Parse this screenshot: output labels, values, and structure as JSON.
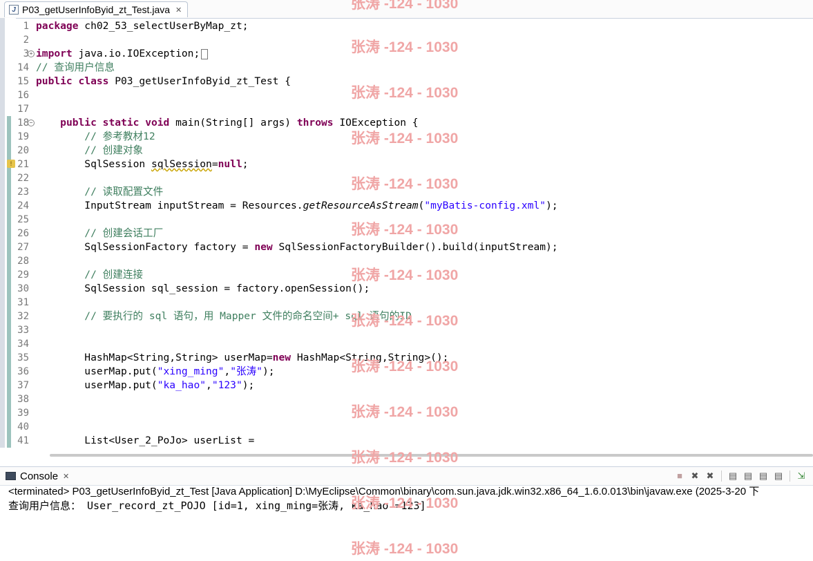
{
  "editor_tab": {
    "title": "P03_getUserInfoByid_zt_Test.java",
    "close": "✕"
  },
  "code_lines": [
    {
      "num": "1",
      "parts": [
        {
          "t": "package",
          "c": "kw"
        },
        {
          "t": " ch02_53_selectUserByMap_zt;"
        }
      ]
    },
    {
      "num": "2",
      "parts": []
    },
    {
      "num": "3",
      "fold": "+",
      "parts": [
        {
          "t": "import",
          "c": "kw"
        },
        {
          "t": " java.io.IOException;"
        }
      ],
      "boxed": true
    },
    {
      "num": "14",
      "parts": [
        {
          "t": "// 查询用户信息",
          "c": "cm"
        }
      ]
    },
    {
      "num": "15",
      "parts": [
        {
          "t": "public",
          "c": "kw"
        },
        {
          "t": " "
        },
        {
          "t": "class",
          "c": "kw"
        },
        {
          "t": " P03_getUserInfoByid_zt_Test {"
        }
      ]
    },
    {
      "num": "16",
      "parts": []
    },
    {
      "num": "17",
      "parts": []
    },
    {
      "num": "18",
      "fold": "−",
      "parts": [
        {
          "t": "    "
        },
        {
          "t": "public",
          "c": "kw"
        },
        {
          "t": " "
        },
        {
          "t": "static",
          "c": "kw"
        },
        {
          "t": " "
        },
        {
          "t": "void",
          "c": "kw"
        },
        {
          "t": " main(String[] args) "
        },
        {
          "t": "throws",
          "c": "kw"
        },
        {
          "t": " IOException {"
        }
      ]
    },
    {
      "num": "19",
      "parts": [
        {
          "t": "        "
        },
        {
          "t": "// 参考教材12",
          "c": "cm"
        }
      ]
    },
    {
      "num": "20",
      "parts": [
        {
          "t": "        "
        },
        {
          "t": "// 创建对象",
          "c": "cm"
        }
      ]
    },
    {
      "num": "21",
      "warn": true,
      "parts": [
        {
          "t": "        SqlSession "
        },
        {
          "t": "sqlSession",
          "c": "squig"
        },
        {
          "t": "="
        },
        {
          "t": "null",
          "c": "kw"
        },
        {
          "t": ";"
        }
      ]
    },
    {
      "num": "22",
      "parts": []
    },
    {
      "num": "23",
      "parts": [
        {
          "t": "        "
        },
        {
          "t": "// 读取配置文件",
          "c": "cm"
        }
      ]
    },
    {
      "num": "24",
      "parts": [
        {
          "t": "        InputStream inputStream = Resources."
        },
        {
          "t": "getResourceAsStream",
          "c": "it"
        },
        {
          "t": "("
        },
        {
          "t": "\"myBatis-config.xml\"",
          "c": "st"
        },
        {
          "t": ");"
        }
      ]
    },
    {
      "num": "25",
      "parts": []
    },
    {
      "num": "26",
      "parts": [
        {
          "t": "        "
        },
        {
          "t": "// 创建会话工厂",
          "c": "cm"
        }
      ]
    },
    {
      "num": "27",
      "parts": [
        {
          "t": "        SqlSessionFactory factory = "
        },
        {
          "t": "new",
          "c": "kw"
        },
        {
          "t": " SqlSessionFactoryBuilder().build(inputStream);"
        }
      ]
    },
    {
      "num": "28",
      "parts": []
    },
    {
      "num": "29",
      "parts": [
        {
          "t": "        "
        },
        {
          "t": "// 创建连接",
          "c": "cm"
        }
      ]
    },
    {
      "num": "30",
      "parts": [
        {
          "t": "        SqlSession sql_session = factory.openSession();"
        }
      ]
    },
    {
      "num": "31",
      "parts": []
    },
    {
      "num": "32",
      "parts": [
        {
          "t": "        "
        },
        {
          "t": "// 要执行的 sql 语句，用 Mapper 文件的命名空间+ sql 语句的ID",
          "c": "cm"
        }
      ]
    },
    {
      "num": "33",
      "parts": []
    },
    {
      "num": "34",
      "parts": []
    },
    {
      "num": "35",
      "parts": [
        {
          "t": "        HashMap<String,String> userMap="
        },
        {
          "t": "new",
          "c": "kw"
        },
        {
          "t": " HashMap<String,String>();"
        }
      ]
    },
    {
      "num": "36",
      "parts": [
        {
          "t": "        userMap.put("
        },
        {
          "t": "\"xing_ming\"",
          "c": "st"
        },
        {
          "t": ","
        },
        {
          "t": "\"张涛\"",
          "c": "st"
        },
        {
          "t": ");"
        }
      ]
    },
    {
      "num": "37",
      "parts": [
        {
          "t": "        userMap.put("
        },
        {
          "t": "\"ka_hao\"",
          "c": "st"
        },
        {
          "t": ","
        },
        {
          "t": "\"123\"",
          "c": "st"
        },
        {
          "t": ");"
        }
      ]
    },
    {
      "num": "38",
      "parts": []
    },
    {
      "num": "39",
      "parts": []
    },
    {
      "num": "40",
      "parts": []
    },
    {
      "num": "41",
      "parts": [
        {
          "t": "        List<User_2_PoJo> userList ="
        }
      ]
    }
  ],
  "console": {
    "tab_label": "Console",
    "close": "✕",
    "status": "<terminated> P03_getUserInfoByid_zt_Test [Java Application] D:\\MyEclipse\\Common\\binary\\com.sun.java.jdk.win32.x86_64_1.6.0.013\\bin\\javaw.exe (2025-3-20 下",
    "output": "查询用户信息： User_record_zt_POJO [id=1, xing_ming=张涛, ka_hao =123]",
    "tools": [
      "■",
      "✖",
      "✖",
      "▤",
      "▤",
      "▤",
      "▤",
      "▤",
      "⇲"
    ]
  },
  "watermark": "张涛 -124 - 1030"
}
